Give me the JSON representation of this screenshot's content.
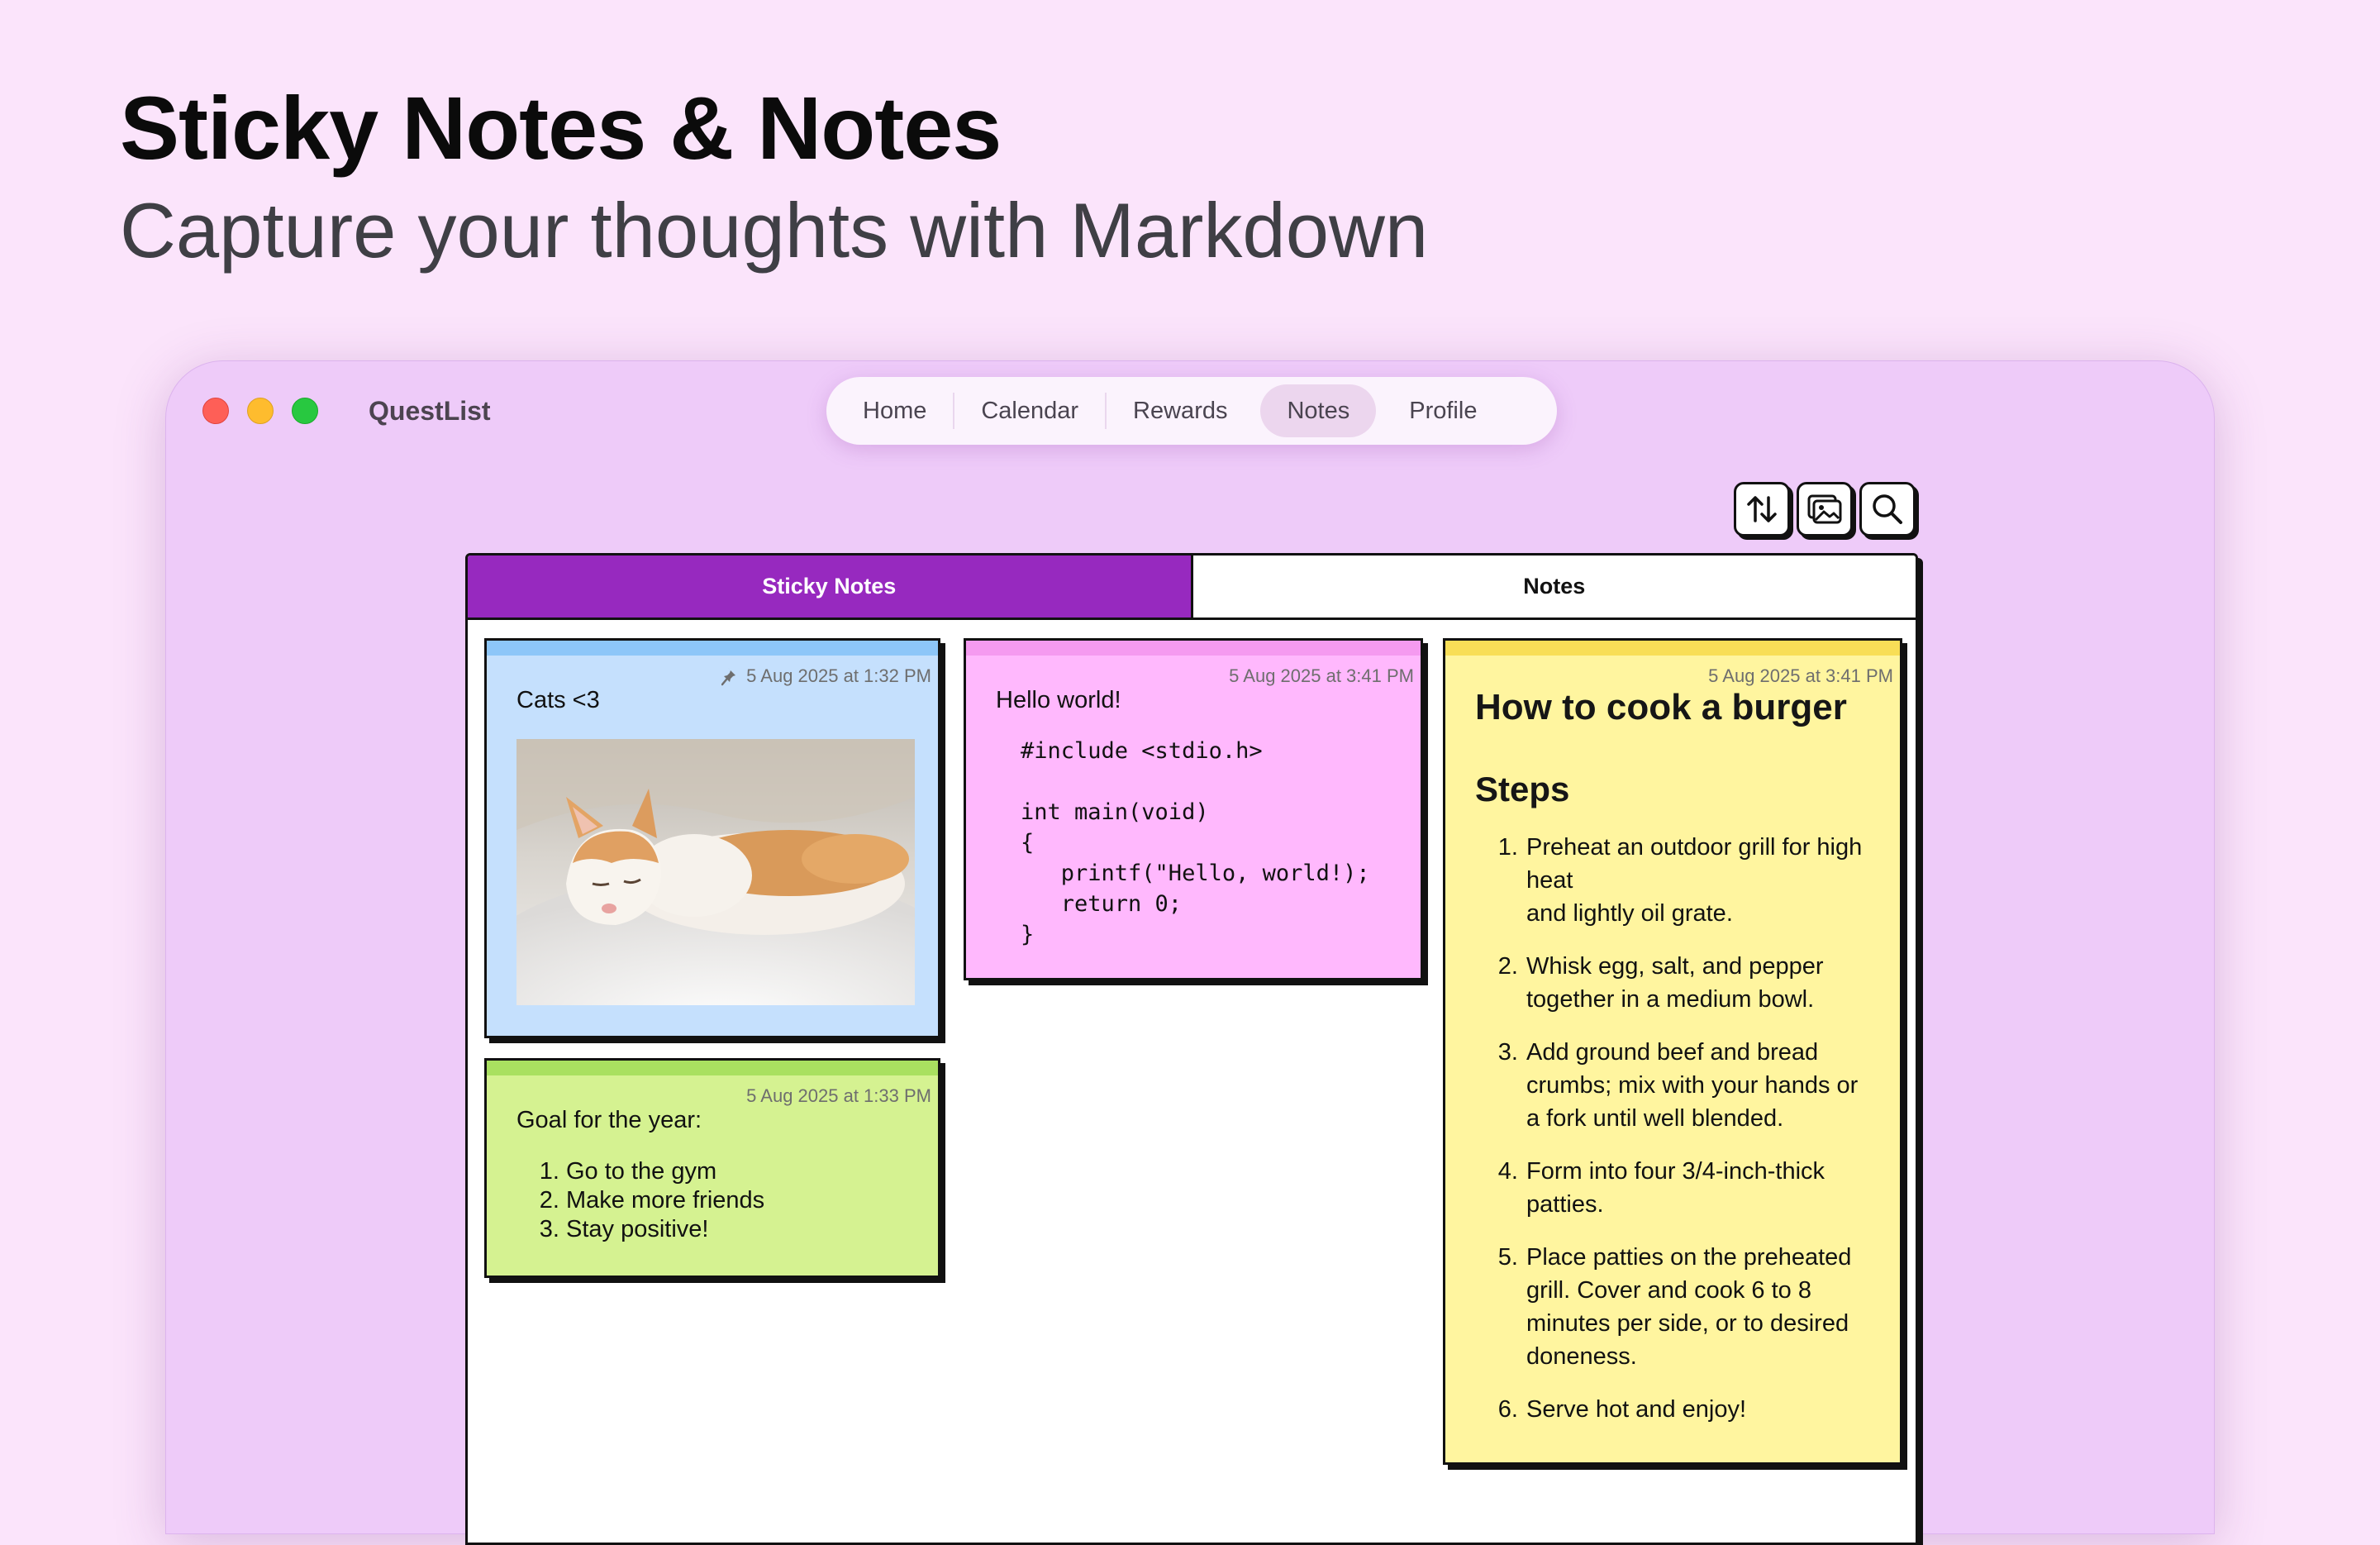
{
  "header": {
    "title": "Sticky Notes & Notes",
    "subtitle": "Capture your thoughts with Markdown"
  },
  "window": {
    "app_title": "QuestList",
    "nav": [
      {
        "label": "Home",
        "active": false
      },
      {
        "label": "Calendar",
        "active": false
      },
      {
        "label": "Rewards",
        "active": false
      },
      {
        "label": "Notes",
        "active": true
      },
      {
        "label": "Profile",
        "active": false
      }
    ]
  },
  "toolbar": {
    "icons": [
      "sort-icon",
      "gallery-icon",
      "search-icon"
    ]
  },
  "tabs": {
    "sticky": "Sticky Notes",
    "notes": "Notes",
    "active": "sticky"
  },
  "notes": {
    "cats": {
      "timestamp": "5 Aug 2025 at 1:32 PM",
      "pinned": true,
      "text": "Cats <3",
      "color": "#c5e0fd"
    },
    "hello": {
      "timestamp": "5 Aug 2025 at 3:41 PM",
      "text": "Hello world!",
      "code": "#include <stdio.h>\n\nint main(void)\n{\n   printf(\"Hello, world!);\n   return 0;\n}",
      "color": "#ffb8fd"
    },
    "goal": {
      "timestamp": "5 Aug 2025 at 1:33 PM",
      "text": "Goal for the year:",
      "items": [
        "Go to the gym",
        "Make more friends",
        "Stay positive!"
      ],
      "color": "#d5f291"
    },
    "burger": {
      "timestamp": "5 Aug 2025 at 3:41 PM",
      "title": "How to cook a burger",
      "heading": "Steps",
      "steps": [
        "Preheat an outdoor grill for high heat\nand lightly oil grate.",
        "Whisk egg, salt, and pepper together in a medium bowl.",
        "Add ground beef and bread crumbs; mix with your hands or a fork until well blended.",
        "Form into four 3/4-inch-thick patties.",
        "Place patties on the preheated grill. Cover and cook 6 to 8 minutes per side, or to desired doneness.",
        "Serve hot and enjoy!"
      ],
      "color": "#fff59f"
    }
  }
}
